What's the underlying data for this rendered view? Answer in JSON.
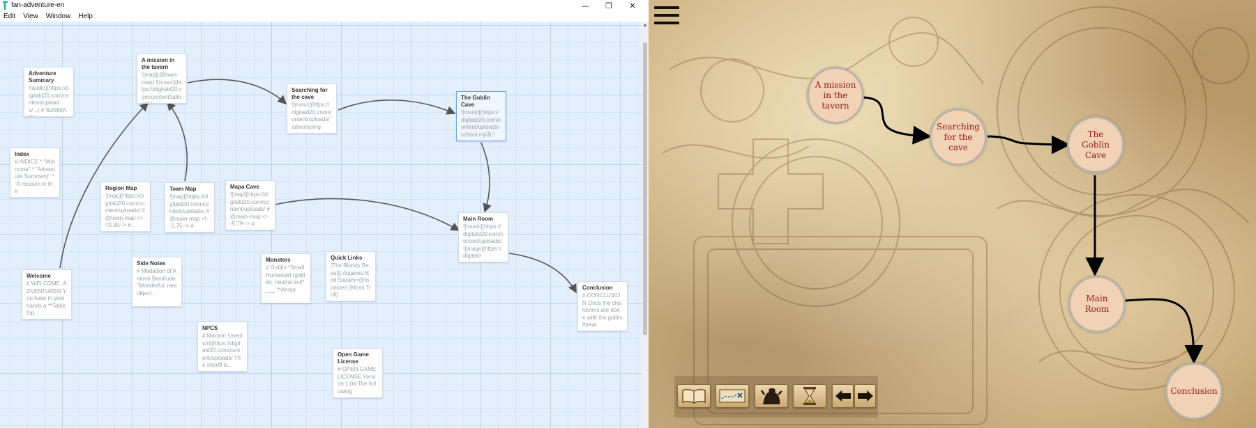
{
  "window": {
    "title": "fan-adventure-en",
    "controls": {
      "minimize": "—",
      "maximize": "❐",
      "close": "✕"
    }
  },
  "menu": [
    "Edit",
    "View",
    "Window",
    "Help"
  ],
  "passages": [
    {
      "title": "Adventure Summary",
      "excerpt": "![audio](https://digitald20.com/content/uploads/...) # SUMMARY"
    },
    {
      "title": "A mission in the tavern",
      "excerpt": "![map](@town-map) ![music](https://digitald20.com/content/uploads/"
    },
    {
      "title": "Searching for the cave",
      "excerpt": "![music](https://digitald20.com/content/uploads/adventuring-"
    },
    {
      "title": "The Goblin Cave",
      "excerpt": "![music](https://digitald20.com/content/uploads/school.mp3) !"
    },
    {
      "title": "Index",
      "excerpt": "# INDICE * \"Welcome\" * \"Adventure Summary\" * \"A mission in the"
    },
    {
      "title": "Region Map",
      "excerpt": "![map](https://digitald20.com/content/uploads/ # @town-map <!--70,39--> #..."
    },
    {
      "title": "Town Map",
      "excerpt": "![map](https://digitald20.com/content/uploads/ # @main-map <!--1,75--> #"
    },
    {
      "title": "Mapa Cave",
      "excerpt": "![map](https://digitald20.com/content/uploads/ # @main-map <!--5,79--> #"
    },
    {
      "title": "Main Room",
      "excerpt": "![music](https://digitald20.com/content/uploads/ ![image](https://digitald"
    },
    {
      "title": "Welcome",
      "excerpt": "# WELCOME, ADVENTURER You have in your hands a **Tabletop"
    },
    {
      "title": "Side Notes",
      "excerpt": "# Medallion of Animal Servitude \"Wonderful, rare object."
    },
    {
      "title": "Monsters",
      "excerpt": "# Goblin *Small Humanoid (goblin), neutral evil* ___ **Armor"
    },
    {
      "title": "Quick Links",
      "excerpt": "[The Bloody Beast](./lugares.html?param=@monster) [Moss Troll]"
    },
    {
      "title": "Conclusion",
      "excerpt": "# CONCLUSION Once the characters are done with the goblin threat"
    },
    {
      "title": "NPCS",
      "excerpt": "# Maroon ![medium](https://digitald20.com/content/uploads/ The sheriff is..."
    },
    {
      "title": "Open Game License",
      "excerpt": "# OPEN GAME LICENSE Version 1.0a The following"
    }
  ],
  "story": {
    "nodes": [
      {
        "label": "A mission in the tavern"
      },
      {
        "label": "Searching for the cave"
      },
      {
        "label": "The Goblin Cave"
      },
      {
        "label": "Main Room"
      },
      {
        "label": "Conclusion"
      }
    ],
    "toolbar": [
      {
        "icon": "book-icon"
      },
      {
        "icon": "map-icon"
      },
      {
        "icon": "monster-icon"
      },
      {
        "icon": "hourglass-icon"
      },
      {
        "icon": "back-arrow-icon"
      },
      {
        "icon": "forward-arrow-icon"
      }
    ]
  },
  "colors": {
    "canvas_bg": "#e3effc",
    "node_fill": "#f2d2b4",
    "node_text": "#8b1a1a",
    "parchment": "#d2b886"
  }
}
